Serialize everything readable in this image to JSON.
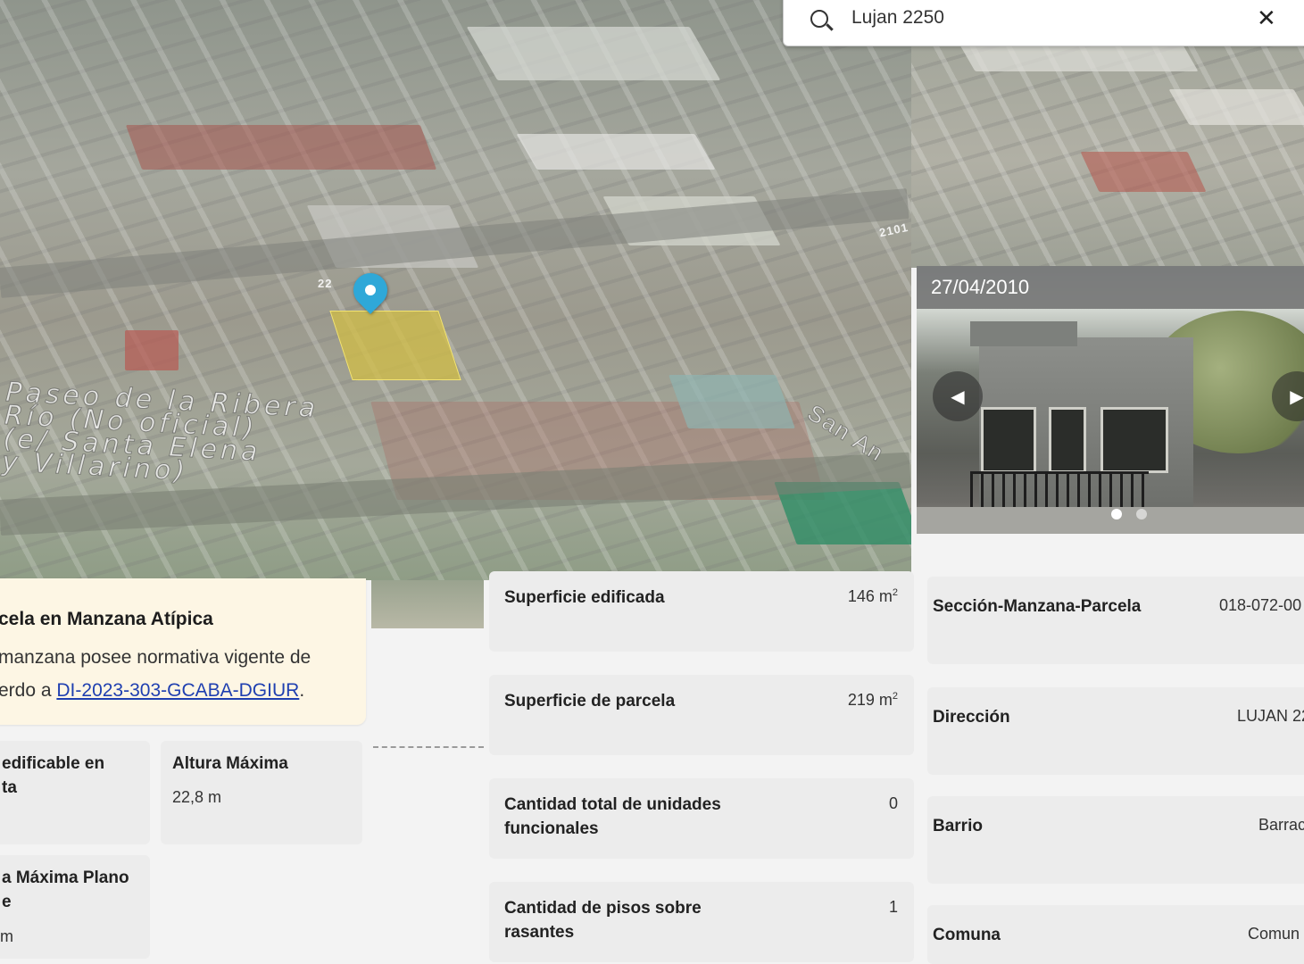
{
  "search": {
    "value": "Lujan 2250",
    "placeholder": "",
    "icon": "search-icon",
    "clear_icon": "close-icon",
    "clear_label": "✕"
  },
  "map": {
    "street_label_1": "22",
    "street_label_2": "2101",
    "area_label": "Paseo de la Ribera\nRío (No oficial)\n(e/ Santa Elena\ny Villarino)",
    "street_label_3": "San An"
  },
  "photo": {
    "date": "27/04/2010",
    "prev_label": "◀",
    "next_label": "▶",
    "slide_count": 2,
    "active_slide": 1
  },
  "alert": {
    "title": "cela en Manzana Atípica",
    "body_line1": "manzana posee normativa vigente de",
    "body_prefix": "erdo a ",
    "link_text": "DI-2023-303-GCABA-DGIUR",
    "body_suffix": "."
  },
  "left_cards": {
    "c1_label": "edificable en\nta",
    "c2_label": "Altura Máxima",
    "c2_value": "22,8 m",
    "c3_label": "a Máxima Plano\ne",
    "c3_value": "m"
  },
  "mid_cards": [
    {
      "label": "Superficie edificada",
      "value": "146 m",
      "sup": "2"
    },
    {
      "label": "Superficie de parcela",
      "value": "219 m",
      "sup": "2"
    },
    {
      "label": "Cantidad total de unidades funcionales",
      "value": "0"
    },
    {
      "label": "Cantidad de pisos sobre rasantes",
      "value": "1"
    }
  ],
  "right_cards": [
    {
      "label": "Sección-Manzana-Parcela",
      "value": "018-072-00"
    },
    {
      "label": "Dirección",
      "value": "LUJAN 22"
    },
    {
      "label": "Barrio",
      "value": "Barrac"
    },
    {
      "label": "Comuna",
      "value": "Comun"
    }
  ]
}
